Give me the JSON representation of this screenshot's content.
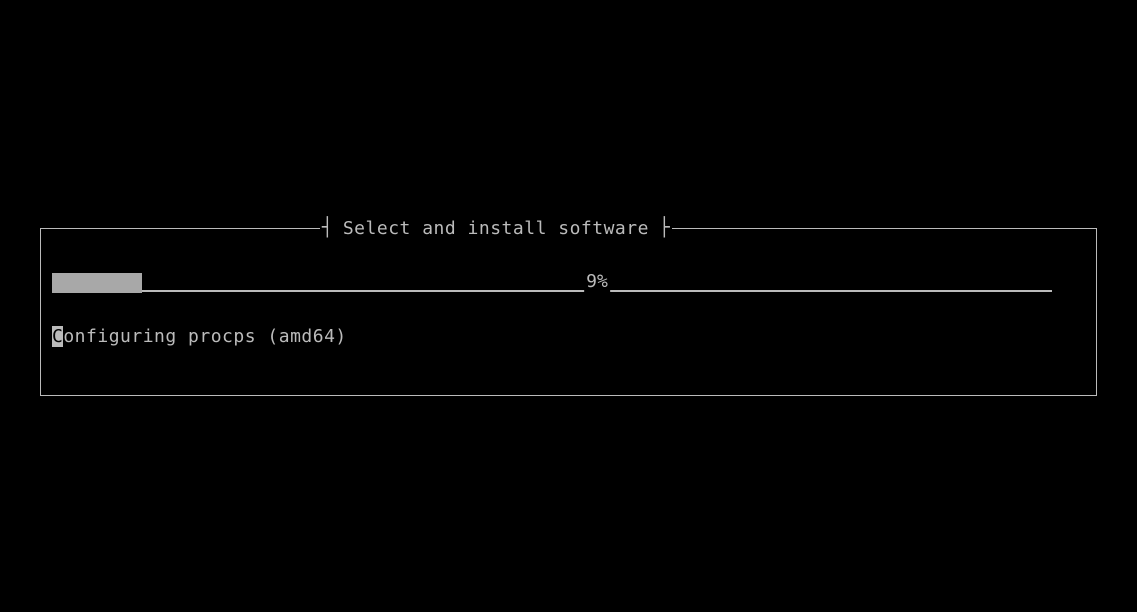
{
  "dialog": {
    "title": "Select and install software",
    "progress_percent_label": "9%",
    "progress_percent_value": 9,
    "status_first_char": "C",
    "status_rest": "onfiguring procps (amd64)"
  }
}
